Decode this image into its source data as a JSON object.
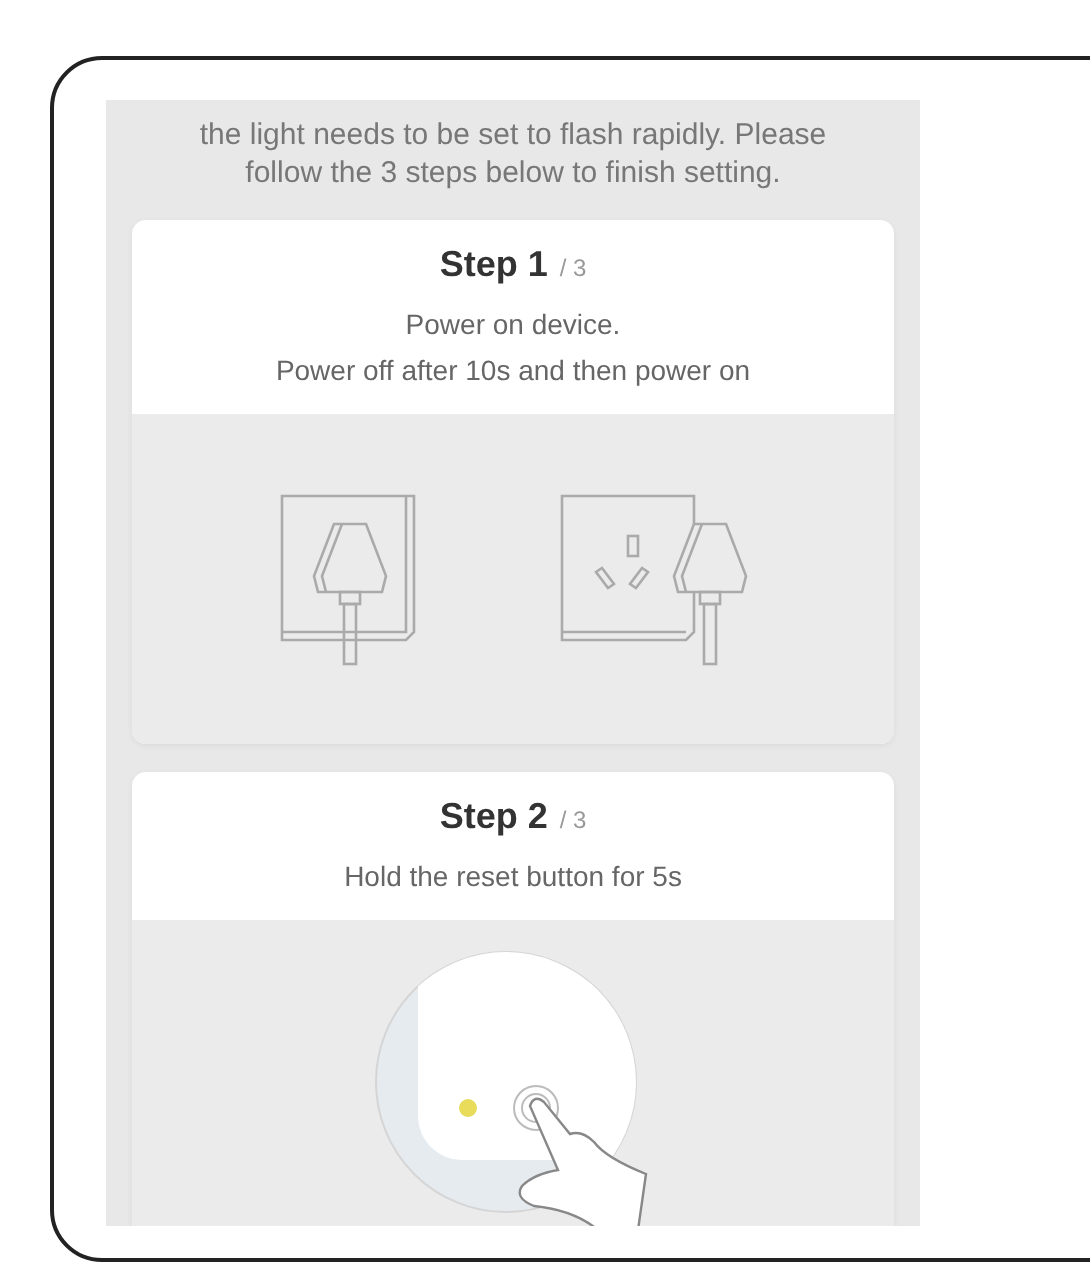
{
  "intro": "the light needs to be set to flash rapidly. Please follow the 3 steps below to finish setting.",
  "steps": [
    {
      "title": "Step 1",
      "total": "/ 3",
      "lines": [
        "Power on device.",
        "Power off after 10s and then power on"
      ],
      "kind": "plugs"
    },
    {
      "title": "Step 2",
      "total": "/ 3",
      "lines": [
        "Hold the reset button for 5s"
      ],
      "kind": "reset"
    }
  ]
}
